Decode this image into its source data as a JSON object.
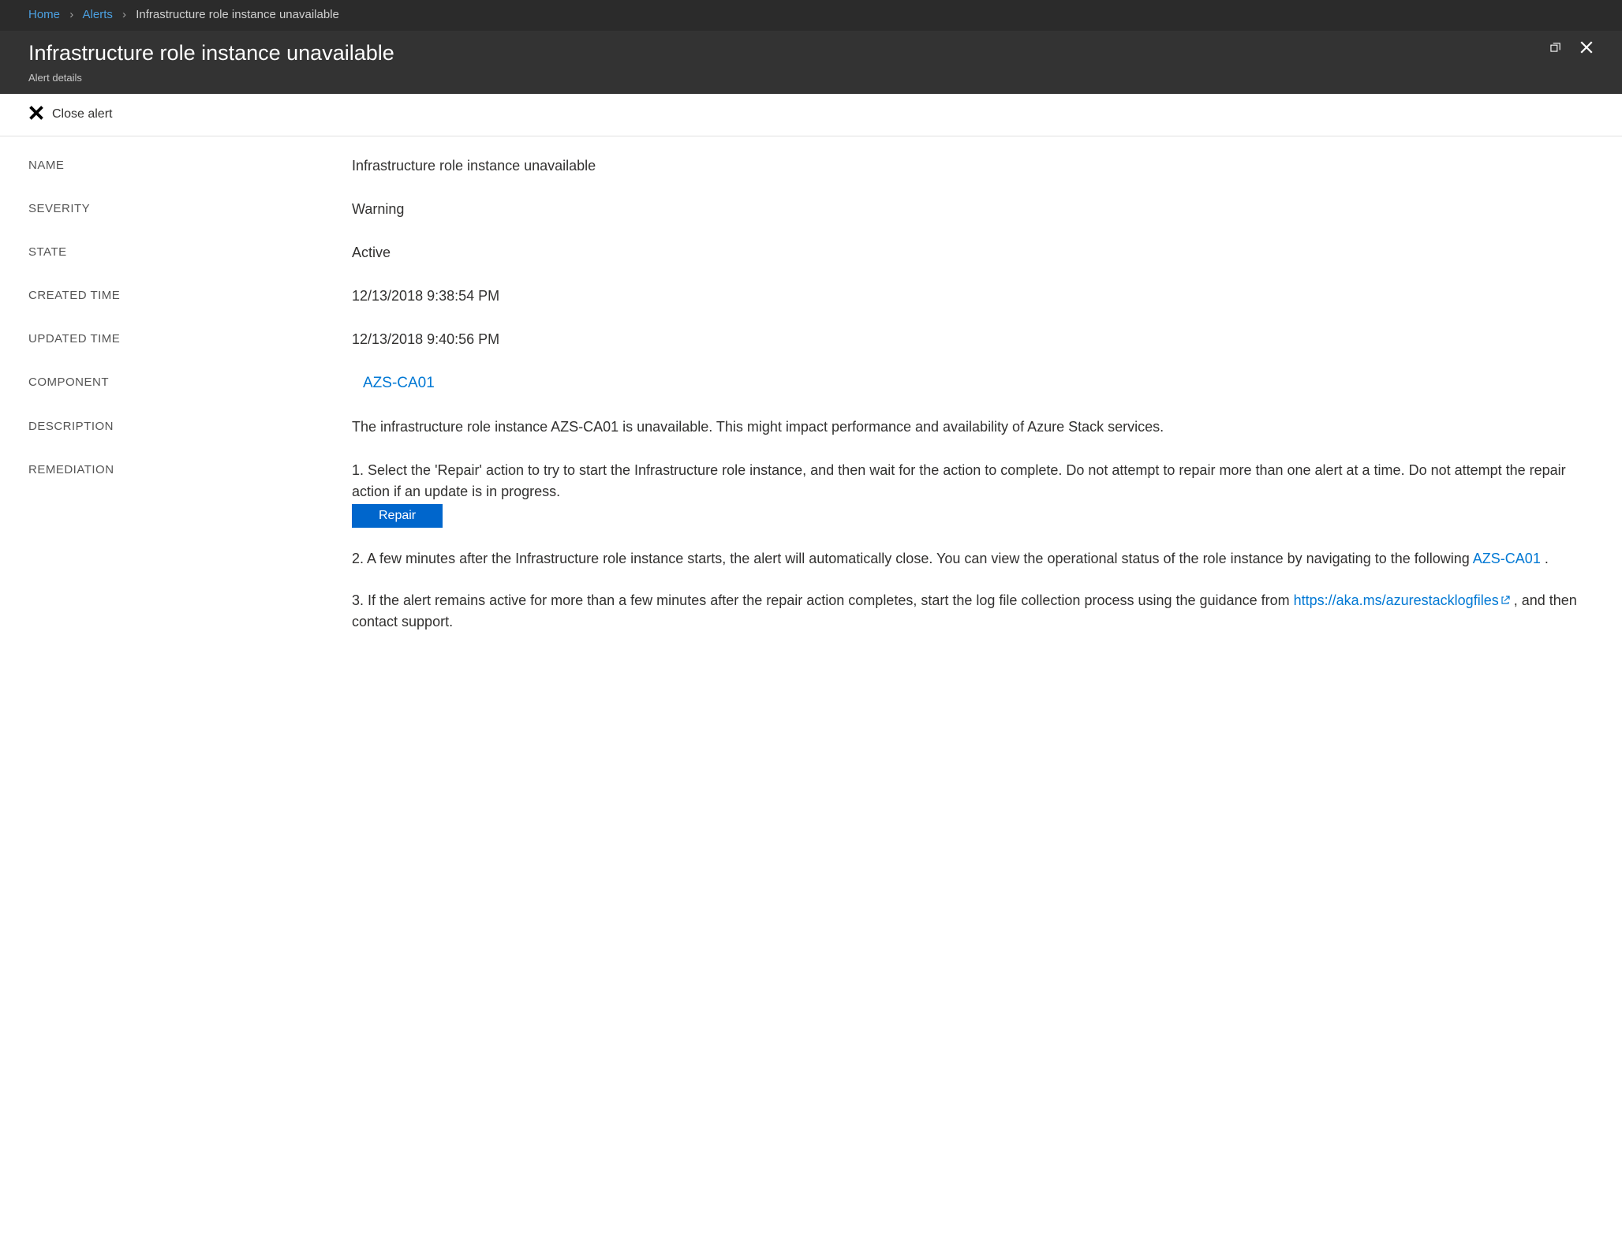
{
  "breadcrumb": {
    "home": "Home",
    "alerts": "Alerts",
    "current": "Infrastructure role instance unavailable"
  },
  "header": {
    "title": "Infrastructure role instance unavailable",
    "subtitle": "Alert details"
  },
  "toolbar": {
    "close_alert": "Close alert"
  },
  "labels": {
    "name": "NAME",
    "severity": "SEVERITY",
    "state": "STATE",
    "created_time": "CREATED TIME",
    "updated_time": "UPDATED TIME",
    "component": "COMPONENT",
    "description": "DESCRIPTION",
    "remediation": "REMEDIATION"
  },
  "values": {
    "name": "Infrastructure role instance unavailable",
    "severity": "Warning",
    "state": "Active",
    "created_time": "12/13/2018 9:38:54 PM",
    "updated_time": "12/13/2018 9:40:56 PM",
    "component": "AZS-CA01",
    "description": "The infrastructure role instance AZS-CA01 is unavailable. This might impact performance and availability of Azure Stack services."
  },
  "remediation": {
    "step1": "1. Select the 'Repair' action to try to start the Infrastructure role instance, and then wait for the action to complete. Do not attempt to repair more than one alert at a time. Do not attempt the repair action if an update is in progress.",
    "repair_button": "Repair",
    "step2_prefix": "2. A few minutes after the Infrastructure role instance starts, the alert will automatically close. You can view the operational status of the role instance by navigating to the following ",
    "step2_link": "AZS-CA01",
    "step2_suffix": " .",
    "step3_prefix": "3. If the alert remains active for more than a few minutes after the repair action completes, start the log file collection process using the guidance from ",
    "step3_link": "https://aka.ms/azurestacklogfiles",
    "step3_suffix": " , and then contact support."
  }
}
